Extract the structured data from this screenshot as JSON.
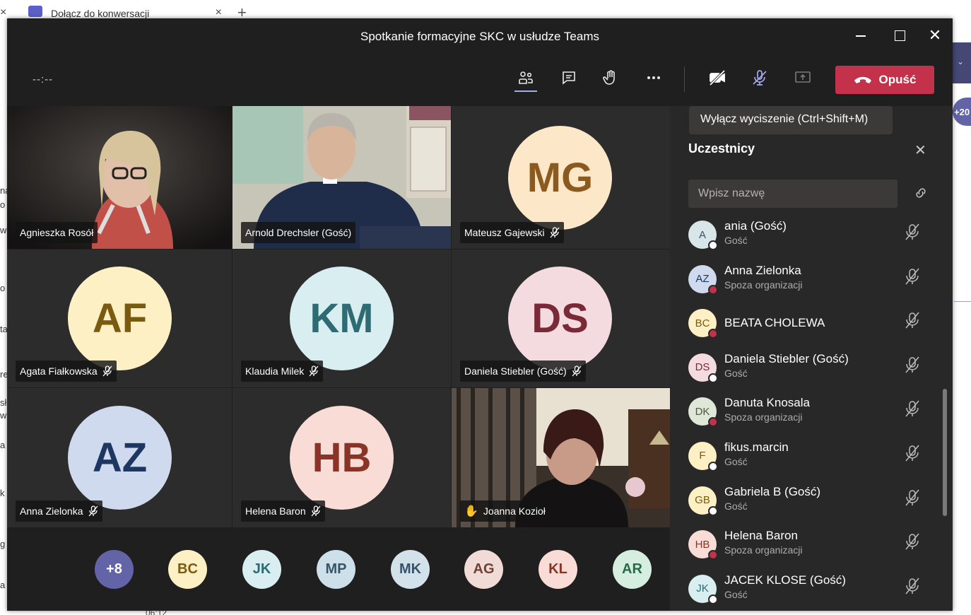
{
  "browser": {
    "tab_title": "Dołącz do konwersacji",
    "close_glyph": "×",
    "new_tab_glyph": "+",
    "side_badge": "+20",
    "footer_time": "06:12",
    "left_fragments": [
      "na",
      "o",
      "w",
      "o",
      "ta",
      "re",
      "sł",
      "wa",
      "a",
      "k",
      "g",
      "a"
    ]
  },
  "window": {
    "title": "Spotkanie formacyjne SKC w usłudze Teams",
    "close_glyph": "✕"
  },
  "meeting": {
    "timer": "--:--",
    "leave_label": "Opuść",
    "icons": [
      "participants-icon",
      "chat-icon",
      "raise-hand-icon",
      "more-options-icon",
      "camera-off-icon",
      "mic-off-icon",
      "share-screen-icon",
      "phone-hangup-icon"
    ]
  },
  "tooltip": {
    "text": "Wyłącz wyciszenie (Ctrl+Shift+M)"
  },
  "tiles": [
    {
      "name": "Agnieszka Rosół",
      "type": "video",
      "muted": false
    },
    {
      "name": "Arnold Drechsler (Gość)",
      "type": "video",
      "muted": false
    },
    {
      "name": "Mateusz Gajewski",
      "initials": "MG",
      "muted": true,
      "bg": "#fde7c9",
      "fg": "#8a5a1e"
    },
    {
      "name": "Agata Fiałkowska",
      "initials": "AF",
      "muted": true,
      "bg": "#fdf0c4",
      "fg": "#7a5a10"
    },
    {
      "name": "Klaudia Milek",
      "initials": "KM",
      "muted": true,
      "bg": "#d8eef0",
      "fg": "#2f6b72"
    },
    {
      "name": "Daniela Stiebler (Gość)",
      "initials": "DS",
      "muted": true,
      "bg": "#f4dbe0",
      "fg": "#7a2a36"
    },
    {
      "name": "Anna Zielonka",
      "initials": "AZ",
      "muted": true,
      "bg": "#cfdaee",
      "fg": "#1d3760"
    },
    {
      "name": "Helena Baron",
      "initials": "HB",
      "muted": true,
      "bg": "#f9dcd6",
      "fg": "#8a3427"
    },
    {
      "name": "Joanna Kozioł",
      "type": "video",
      "hand_raised": true,
      "hand_glyph": "✋"
    }
  ],
  "overflow": [
    {
      "label": "+8",
      "bg": "#6264a7",
      "fg": "#ffffff"
    },
    {
      "label": "BC",
      "bg": "#fdf0c4",
      "fg": "#7a5a10"
    },
    {
      "label": "JK",
      "bg": "#d8eef0",
      "fg": "#2f6b72"
    },
    {
      "label": "MP",
      "bg": "#cde0ea",
      "fg": "#35546a"
    },
    {
      "label": "MK",
      "bg": "#d3e2ea",
      "fg": "#35546a"
    },
    {
      "label": "AG",
      "bg": "#f1dbd6",
      "fg": "#6e4036"
    },
    {
      "label": "KL",
      "bg": "#f9dcd6",
      "fg": "#8a3427"
    },
    {
      "label": "AR",
      "bg": "#d5eee0",
      "fg": "#2a6b45"
    }
  ],
  "panel": {
    "title": "Uczestnicy",
    "search_placeholder": "Wpisz nazwę",
    "close_glyph": "✕",
    "participants": [
      {
        "initials": "A",
        "name": "ania (Gość)",
        "sub": "Gość",
        "bg": "#d8e6ea",
        "fg": "#35546a",
        "status": "white"
      },
      {
        "initials": "AZ",
        "name": "Anna Zielonka",
        "sub": "Spoza organizacji",
        "bg": "#cfdaee",
        "fg": "#1d3760",
        "status": "red"
      },
      {
        "initials": "BC",
        "name": "BEATA CHOLEWA",
        "sub": "",
        "bg": "#fdf0c4",
        "fg": "#7a5a10",
        "status": "red"
      },
      {
        "initials": "DS",
        "name": "Daniela Stiebler (Gość)",
        "sub": "Gość",
        "bg": "#f4dbe0",
        "fg": "#7a2a36",
        "status": "white"
      },
      {
        "initials": "DK",
        "name": "Danuta Knosala",
        "sub": "Spoza organizacji",
        "bg": "#dfe7d8",
        "fg": "#4a5a3a",
        "status": "red"
      },
      {
        "initials": "F",
        "name": "fikus.marcin",
        "sub": "Gość",
        "bg": "#fdf0c4",
        "fg": "#7a5a10",
        "status": "white"
      },
      {
        "initials": "GB",
        "name": "Gabriela B (Gość)",
        "sub": "Gość",
        "bg": "#fdf0c4",
        "fg": "#7a5a10",
        "status": "white"
      },
      {
        "initials": "HB",
        "name": "Helena Baron",
        "sub": "Spoza organizacji",
        "bg": "#f9dcd6",
        "fg": "#8a3427",
        "status": "red"
      },
      {
        "initials": "JK",
        "name": "JACEK KLOSE (Gość)",
        "sub": "Gość",
        "bg": "#d8eef0",
        "fg": "#2f6b72",
        "status": "white"
      }
    ]
  },
  "colors": {
    "leave": "#c4314b",
    "accent": "#a7a9ee",
    "status_red": "#c4314b",
    "status_white": "#ffffff"
  }
}
